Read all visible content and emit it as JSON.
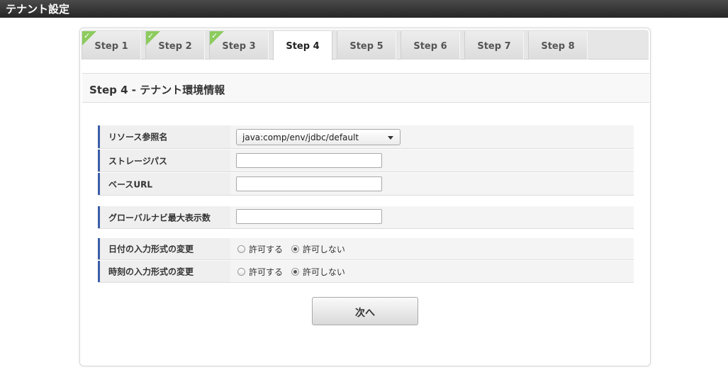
{
  "window": {
    "title": "テナント設定"
  },
  "tabs": [
    {
      "label": "Step 1",
      "completed": true,
      "active": false
    },
    {
      "label": "Step 2",
      "completed": true,
      "active": false
    },
    {
      "label": "Step 3",
      "completed": true,
      "active": false
    },
    {
      "label": "Step 4",
      "completed": false,
      "active": true
    },
    {
      "label": "Step 5",
      "completed": false,
      "active": false
    },
    {
      "label": "Step 6",
      "completed": false,
      "active": false
    },
    {
      "label": "Step 7",
      "completed": false,
      "active": false
    },
    {
      "label": "Step 8",
      "completed": false,
      "active": false
    }
  ],
  "check_glyph": "✓",
  "section": {
    "title": "Step 4 - テナント環境情報"
  },
  "form": {
    "resource_ref": {
      "label": "リソース参照名",
      "value": "java:comp/env/jdbc/default"
    },
    "storage_path": {
      "label": "ストレージパス",
      "value": ""
    },
    "base_url": {
      "label": "ベースURL",
      "value": ""
    },
    "global_nav_max": {
      "label": "グローバルナビ最大表示数",
      "value": ""
    },
    "date_format_change": {
      "label": "日付の入力形式の変更",
      "options": [
        "許可する",
        "許可しない"
      ],
      "selected": "許可しない"
    },
    "time_format_change": {
      "label": "時刻の入力形式の変更",
      "options": [
        "許可する",
        "許可しない"
      ],
      "selected": "許可しない"
    }
  },
  "buttons": {
    "next": "次へ"
  },
  "colors": {
    "titlebar": "#2f2f2f",
    "check": "#8ccb5e",
    "label_accent": "#3b5ea8"
  },
  "icons": {
    "completed": "checkmark-icon",
    "dropdown": "chevron-down-icon"
  }
}
